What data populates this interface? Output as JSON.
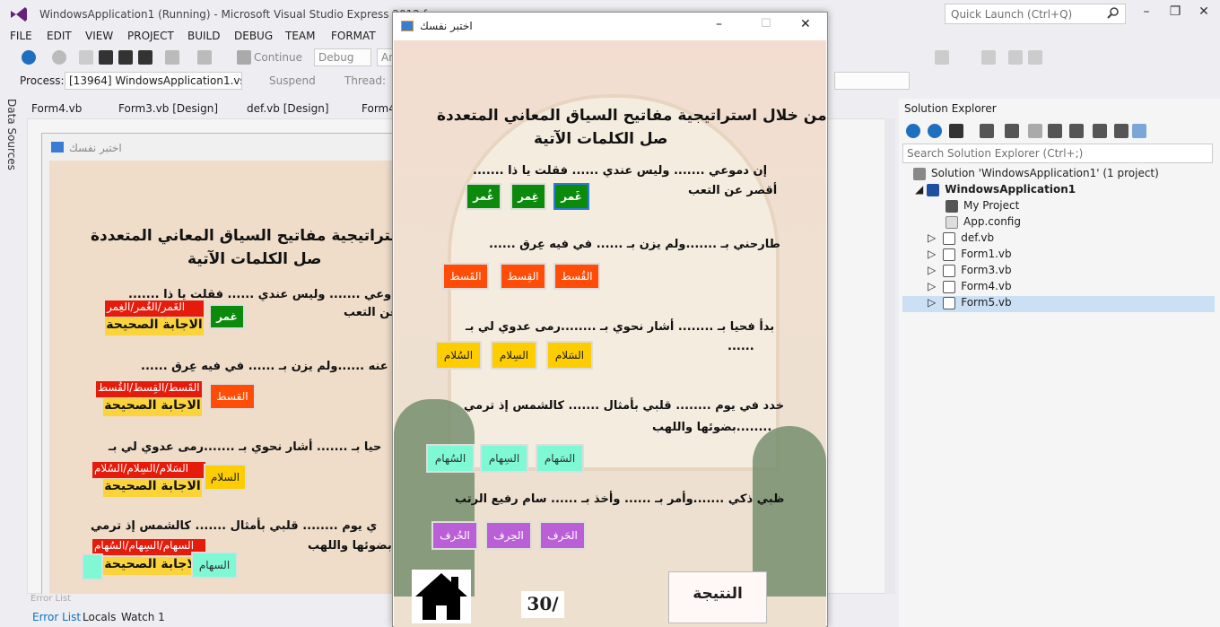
{
  "ide": {
    "title": "WindowsApplication1 (Running) - Microsoft Visual Studio Express 2012 for",
    "quick_launch": "Quick Launch (Ctrl+Q)",
    "menu": [
      "FILE",
      "EDIT",
      "VIEW",
      "PROJECT",
      "BUILD",
      "DEBUG",
      "TEAM",
      "FORMAT"
    ],
    "toolbar": {
      "continue": "Continue",
      "debug_combo": "Debug",
      "any_combo": "An"
    },
    "process_label": "Process:",
    "process_value": "[13964] WindowsApplication1.vsho",
    "suspend": "Suspend",
    "thread": "Thread:",
    "tabs": [
      "Form4.vb",
      "Form3.vb [Design]",
      "def.vb [Design]",
      "Form4"
    ],
    "data_sources": "Data Sources",
    "bottom_tabs": [
      "Error List",
      "Locals",
      "Watch 1"
    ],
    "error_list_caption": "Error List"
  },
  "solution_explorer": {
    "title": "Solution Explorer",
    "search_placeholder": "Search Solution Explorer (Ctrl+;)",
    "items": [
      {
        "label": "Solution 'WindowsApplication1' (1 project)"
      },
      {
        "label": "WindowsApplication1"
      },
      {
        "label": "My Project"
      },
      {
        "label": "App.config"
      },
      {
        "label": "def.vb"
      },
      {
        "label": "Form1.vb"
      },
      {
        "label": "Form3.vb"
      },
      {
        "label": "Form4.vb"
      },
      {
        "label": "Form5.vb"
      }
    ]
  },
  "design_form": {
    "title": "اختبر نفسك",
    "heading1": "استراتيجية مفاتيح السياق المعاني المتعددة",
    "heading2": "صل الكلمات الآتية",
    "q1": "وعي ....... وليس عندي ...... فقلت يا ذا .......",
    "q1b": "عن التعب",
    "q1_wrong": "الغَمر/الغُمر/الغِمر",
    "correct": "الاجابة الصحيحة",
    "q1_btn": "غمر",
    "q2": "ي عنه ......ولم يزن بـ ...... في فيه عِرق ......",
    "q2_wrong": "القَسط/القِسط/القُسط",
    "q2_btn": "القسط",
    "q3": "حيا بـ ....... أشار نحوي بـ .......رمى عدوي لي بـ",
    "q3_wrong": "السَلام/السِلام/السُلام",
    "q3_btn": "السلام",
    "q4": "ي يوم ........ قلبي بأمثال ....... كالشمس إذ ترمي",
    "q4b": "بضوئها واللهب",
    "q4_wrong": "السهام/السِهام/السُهام",
    "q4_btn": "السهام"
  },
  "run_form": {
    "title": "اختبر نفسك",
    "heading1": "من خلال استراتيجية مفاتيح السياق المعاني المتعددة",
    "heading2": "صل الكلمات الآتية",
    "q1": "إن دموعي ....... وليس عندي ...... فقلت يا ذا .......",
    "q1b": "أقصر عن التعب",
    "q1_opts": [
      "غُمر",
      "غِمر",
      "غَمر"
    ],
    "q2": "طارحني بـ .......ولم يزن بـ ...... في فيه عِرق ......",
    "q2_opts": [
      "القَسط",
      "القِسط",
      "القُسط"
    ],
    "q3": "بدأ فحيا بـ ........ أشار نحوي  بـ ........رمى عدوي لي بـ",
    "q3b": "......",
    "q3_opts": [
      "السُلام",
      "السِلام",
      "السَلام"
    ],
    "q4": "خدد في يوم ........ قلبي بأمثال ....... كالشمس إذ ترمي",
    "q4b": "........بضوئها واللهب",
    "q4_opts": [
      "السُهام",
      "السِهام",
      "السَهام"
    ],
    "q5": "ظبي ذكي .......وأمر بـ ...... وأخذ بـ ...... سام رفيع الرتب",
    "q5_opts": [
      "الحُرف",
      "الحِرف",
      "الحَرف"
    ],
    "score": "30/",
    "result_button": "النتيجة"
  },
  "colors": {
    "green": "#0b8a0b",
    "orange": "#ff4d08",
    "yellow": "#fecd00",
    "mint": "#7ff8d4",
    "purple": "#bb5fd6",
    "red": "#e51b0c"
  }
}
